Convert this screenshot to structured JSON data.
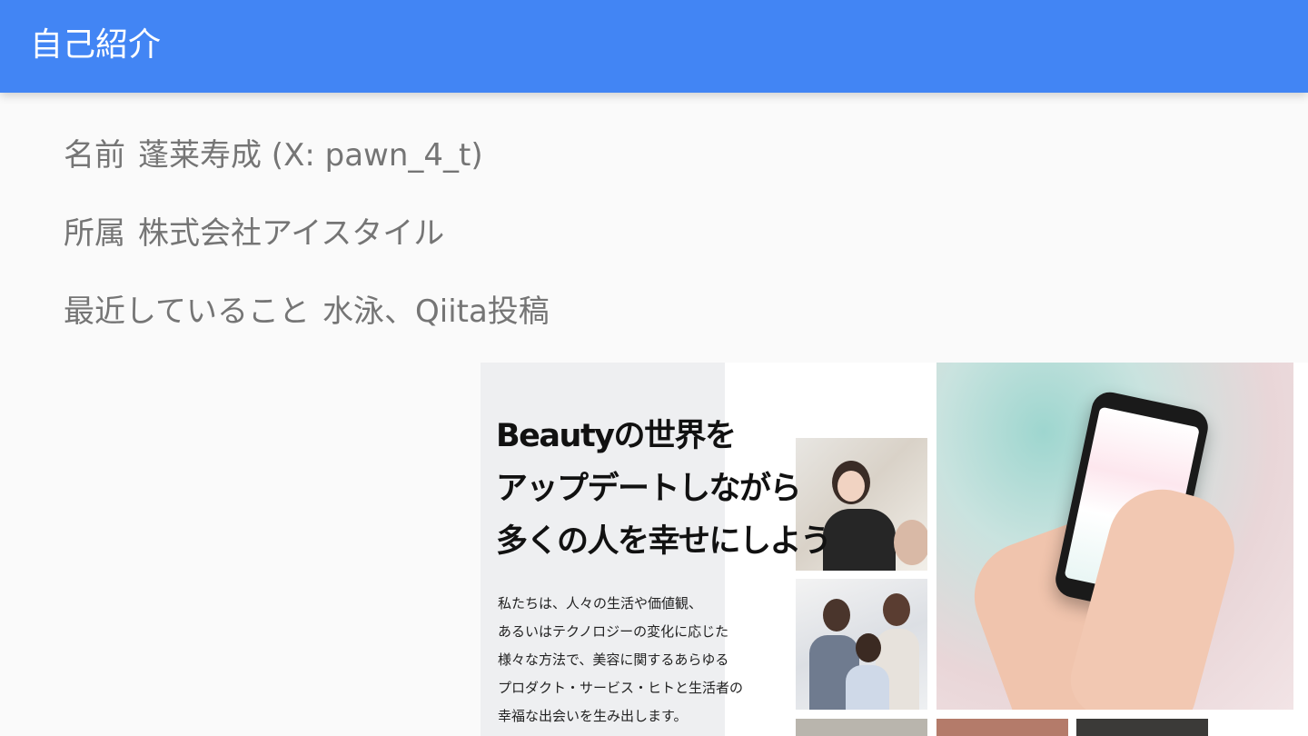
{
  "header": {
    "title": "自己紹介"
  },
  "bullets": [
    {
      "key": "名前",
      "value": "蓬莱寿成 (X: pawn_4_t)"
    },
    {
      "key": "所属",
      "value": "株式会社アイスタイル"
    },
    {
      "key": "最近していること",
      "value": "水泳、Qiita投稿"
    }
  ],
  "hero": {
    "headline": [
      "Beautyの世界を",
      "アップデートしながら",
      "多くの人を幸せにしよう"
    ],
    "body": [
      "私たちは、人々の生活や価値観、",
      "あるいはテクノロジーの変化に応じた",
      "様々な方法で、美容に関するあらゆる",
      "プロダクト・サービス・ヒトと生活者の",
      "幸福な出会いを生み出します。"
    ]
  },
  "colors": {
    "header_bg": "#4285f4",
    "header_text": "#ffffff",
    "body_text": "#757575",
    "page_bg": "#fafafa"
  }
}
